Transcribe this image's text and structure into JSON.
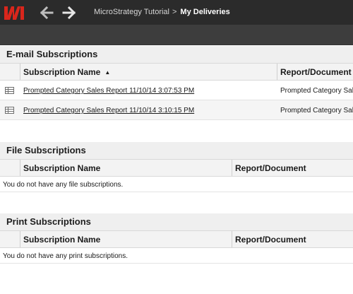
{
  "breadcrumb": {
    "parent": "MicroStrategy Tutorial",
    "separator": ">",
    "current": "My Deliveries"
  },
  "icons": {
    "logo": "microstrategy-logo",
    "back": "arrow-left-icon",
    "forward": "arrow-right-icon",
    "row": "grid-report-icon"
  },
  "colors": {
    "brand_red": "#d9261c",
    "topbar": "#2b2b2b"
  },
  "email": {
    "title": "E-mail Subscriptions",
    "col_name": "Subscription Name",
    "col_doc": "Report/Document",
    "rows": [
      {
        "name": "Prompted Category Sales Report 11/10/14 3:07:53 PM",
        "doc": "Prompted Category Sales"
      },
      {
        "name": "Prompted Category Sales Report 11/10/14 3:10:15 PM",
        "doc": "Prompted Category Sales"
      }
    ]
  },
  "file": {
    "title": "File Subscriptions",
    "col_name": "Subscription Name",
    "col_doc": "Report/Document",
    "empty": "You do not have any file subscriptions."
  },
  "print": {
    "title": "Print Subscriptions",
    "col_name": "Subscription Name",
    "col_doc": "Report/Document",
    "empty": "You do not have any print subscriptions."
  }
}
